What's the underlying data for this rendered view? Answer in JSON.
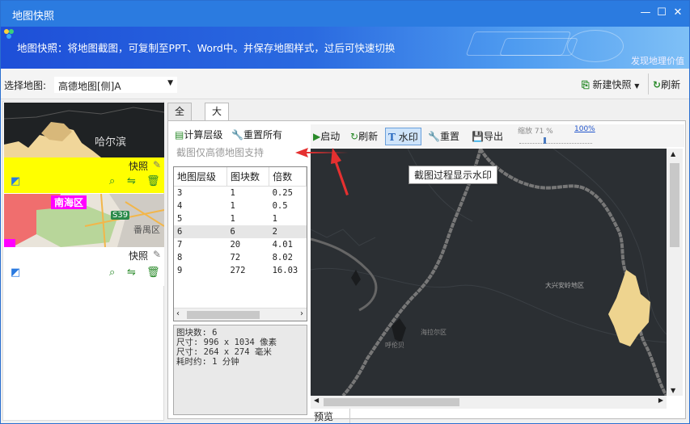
{
  "window": {
    "title": "地图快照"
  },
  "banner": {
    "description": "地图快照：将地图截图，可复制至PPT、Word中。并保存地图样式，过后可快速切换",
    "slogan": "发现地理价值"
  },
  "toolbar": {
    "select_label": "选择地图:",
    "selected_map": "高德地图[侧]A",
    "new_snapshot": "新建快照",
    "refresh": "刷新"
  },
  "thumbnails": [
    {
      "city": "哈尔滨",
      "label": "快照"
    },
    {
      "district": "南海区",
      "road": "S39",
      "district2": "番禺区",
      "label": "快照"
    }
  ],
  "tabs": [
    {
      "label": "全图"
    },
    {
      "label": "大图"
    }
  ],
  "calc": {
    "compute_levels": "计算层级",
    "reset_all": "重置所有",
    "note": "截图仅高德地图支持"
  },
  "table": {
    "headers": [
      "地图层级",
      "图块数",
      "倍数"
    ],
    "rows": [
      [
        "3",
        "1",
        "0.25"
      ],
      [
        "4",
        "1",
        "0.5"
      ],
      [
        "5",
        "1",
        "1"
      ],
      [
        "6",
        "6",
        "2"
      ],
      [
        "7",
        "20",
        "4.01"
      ],
      [
        "8",
        "72",
        "8.02"
      ],
      [
        "9",
        "272",
        "16.03"
      ]
    ]
  },
  "info": {
    "line1": "图块数: 6",
    "line2": "尺寸: 996 x 1034 像素",
    "line3": "尺寸: 264 x 274 毫米",
    "line4": "耗时约: 1 分钟"
  },
  "right_toolbar": {
    "start": "启动",
    "refresh": "刷新",
    "watermark": "水印",
    "reset": "重置",
    "export": "导出",
    "scale_label": "缩放 71 %",
    "scale_100": "100%"
  },
  "tooltip": "截图过程显示水印",
  "map": {
    "label1": "大兴安岭地区",
    "label2": "海拉尔区",
    "label3": "呼伦贝"
  },
  "preview_label": "预览",
  "colors": {
    "accent": "#2b7be0",
    "highlight_thumb": "#ffff00",
    "arrow": "#e53030"
  }
}
